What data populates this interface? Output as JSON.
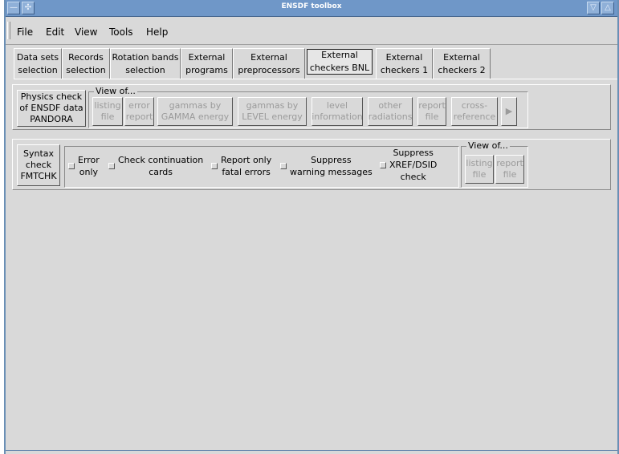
{
  "window": {
    "title": "ENSDF toolbox"
  },
  "menu": [
    "File",
    "Edit",
    "View",
    "Tools",
    "Help"
  ],
  "tabs": [
    "Data sets\nselection",
    "Records\nselection",
    "Rotation bands\nselection",
    "External\nprograms",
    "External\npreprocessors",
    "External\ncheckers BNL",
    "External\ncheckers 1",
    "External\ncheckers 2"
  ],
  "active_tab": "External checkers BNL",
  "pandora": {
    "run_label": "Physics check\nof ENSDF data\nPANDORA",
    "view_title": "View of...",
    "view_buttons": [
      "listing\nfile",
      "error\nreport",
      "gammas by\nGAMMA energy",
      "gammas by\nLEVEL energy",
      "level\ninformation",
      "other\nradiations",
      "report\nfile",
      "cross-\nreference"
    ]
  },
  "fmtchk": {
    "run_label": "Syntax\ncheck\nFMTCHK",
    "options": [
      "Error\nonly",
      "Check continuation\ncards",
      "Report only\nfatal errors",
      "Suppress\nwarning messages",
      "Suppress\nXREF/DSID\ncheck"
    ],
    "view_title": "View of...",
    "view_buttons": [
      "listing\nfile",
      "report\nfile"
    ]
  }
}
